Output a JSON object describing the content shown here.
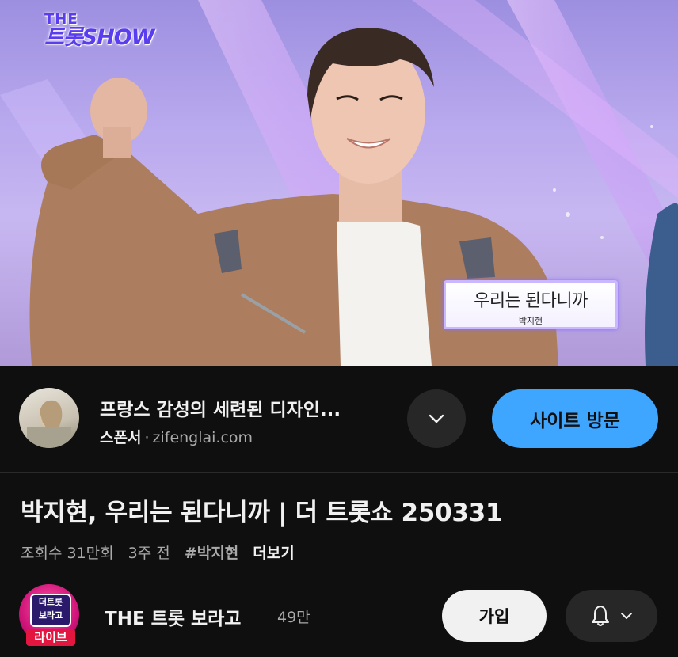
{
  "video": {
    "logo_line1": "THE",
    "logo_line2": "트롯SHOW",
    "caption_title": "우리는 된다니까",
    "caption_sub": "박지현"
  },
  "ad": {
    "title": "프랑스 감성의 세련된 디자인...",
    "sponsor_label": "스폰서",
    "separator": "·",
    "domain": "zifenglai.com",
    "expand_icon": "chevron-down-icon",
    "visit_label": "사이트 방문",
    "accent": "#3ea6ff"
  },
  "video_info": {
    "title": "박지현, 우리는 된다니까 | 더 트롯쇼 250331",
    "views": "조회수 31만회",
    "age": "3주 전",
    "hashtag": "#박지현",
    "more_label": "더보기"
  },
  "channel": {
    "avatar_text_top": "더트롯",
    "avatar_text_bottom": "보라고",
    "live_badge": "라이브",
    "name": "THE 트롯 보라고",
    "subscribers": "49만",
    "join_label": "가입",
    "bell_icon": "bell-icon",
    "dropdown_icon": "chevron-down-icon"
  }
}
